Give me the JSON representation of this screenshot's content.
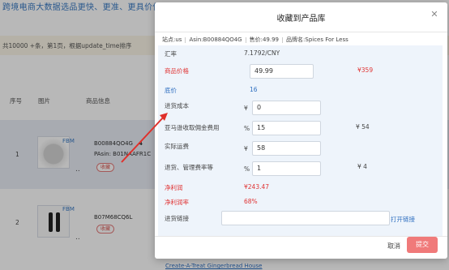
{
  "background": {
    "banner": "跨境电商大数据选品更快、更准、更具价值",
    "summary": "共10000 +条，第1页，根据update_time排序",
    "headers": {
      "index": "序号",
      "image": "图片",
      "product_info": "商品信息"
    },
    "rows": [
      {
        "num": "1",
        "fulfil": "FBM",
        "asin": "B00884QO4G",
        "star": "4",
        "parent": "PAsin: B01NAAFR1C",
        "tag": "收藏"
      },
      {
        "num": "2",
        "fulfil": "FBM",
        "asin": "B07M68CQ6L",
        "tag": "收藏"
      }
    ],
    "bottom_link": "Create-A-Treat Gingerbread House"
  },
  "modal": {
    "title": "收藏到产品库",
    "close_icon": "close-icon",
    "info": {
      "site": "站点:us",
      "asin": "Asin:B00884QO4G",
      "price": "售价:49.99",
      "brand": "品牌名:Spices For Less"
    },
    "exchange_rate": {
      "label": "汇率",
      "value": "7.1792/CNY"
    },
    "product_price": {
      "label": "商品价格",
      "value": "49.99",
      "converted": "¥359"
    },
    "floor_price": {
      "label": "底价",
      "value": "16"
    },
    "purchase_cost": {
      "label": "进货成本",
      "prefix": "¥",
      "value": "0"
    },
    "commission": {
      "label": "亚马逊收取佣金费用",
      "prefix": "%",
      "value": "15",
      "converted": "¥ 54"
    },
    "shipping": {
      "label": "实际运费",
      "prefix": "¥",
      "value": "58"
    },
    "returns": {
      "label": "退货、管理费率等",
      "prefix": "%",
      "value": "1",
      "converted": "¥ 4"
    },
    "net_profit": {
      "label": "净利润",
      "value": "¥243.47"
    },
    "net_margin": {
      "label": "净利润率",
      "value": "68%"
    },
    "purchase_link": {
      "label": "进货链接",
      "value": "",
      "open_label": "打开链接"
    },
    "cancel_label": "取消",
    "submit_label": "提交"
  },
  "colors": {
    "accent_red": "#e03434",
    "link_blue": "#2f6fc0",
    "submit_bg": "#f07a7a",
    "panel_bg": "#eef4fb"
  }
}
